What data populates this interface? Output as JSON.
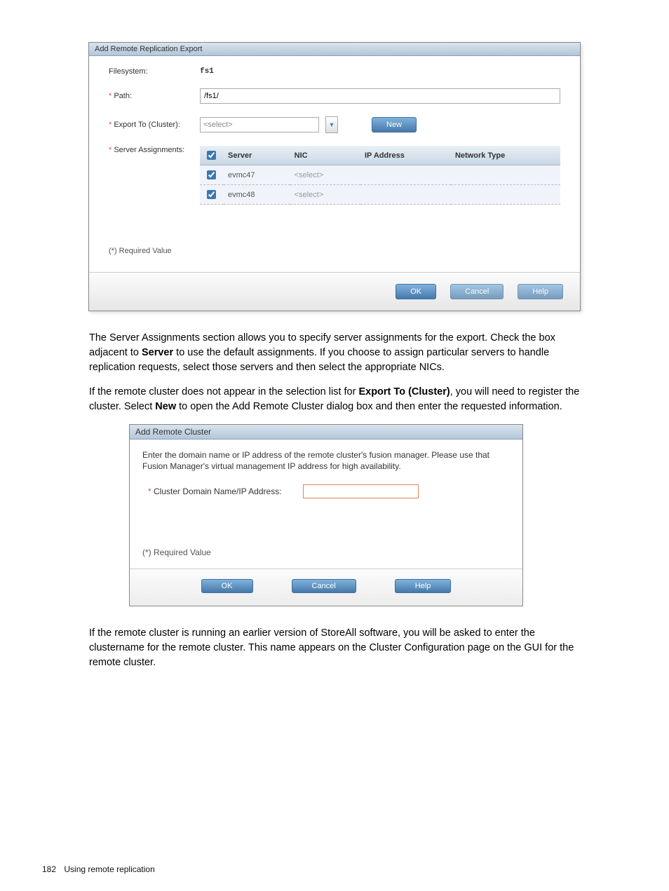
{
  "dialog1": {
    "title": "Add Remote Replication Export",
    "labels": {
      "filesystem": "Filesystem:",
      "path": "Path:",
      "export_to": "Export To (Cluster):",
      "server_assign": "Server Assignments:"
    },
    "values": {
      "filesystem": "fs1",
      "path": "/fs1/",
      "export_placeholder": "<select>"
    },
    "new_btn": "New",
    "table": {
      "headers": {
        "server": "Server",
        "nic": "NIC",
        "ip": "IP Address",
        "nettype": "Network Type"
      },
      "rows": [
        {
          "server": "evmc47",
          "nic": "<select>",
          "ip": "",
          "nettype": ""
        },
        {
          "server": "evmc48",
          "nic": "<select>",
          "ip": "",
          "nettype": ""
        }
      ]
    },
    "required_note": "(*) Required Value",
    "buttons": {
      "ok": "OK",
      "cancel": "Cancel",
      "help": "Help"
    }
  },
  "prose1": {
    "text_a": "The Server Assignments section allows you to specify server assignments for the export. Check the box adjacent to ",
    "bold_a": "Server",
    "text_b": " to use the default assignments. If you choose to assign particular servers to handle replication requests, select those servers and then select the appropriate NICs."
  },
  "prose2": {
    "text_a": "If the remote cluster does not appear in the selection list for ",
    "bold_a": "Export To (Cluster)",
    "text_b": ", you will need to register the cluster. Select ",
    "bold_b": "New",
    "text_c": " to open the Add Remote Cluster dialog box and then enter the requested information."
  },
  "dialog2": {
    "title": "Add Remote Cluster",
    "instruction": "Enter the domain name or IP address of the remote cluster's fusion manager. Please use that Fusion Manager's virtual management IP address for high availability.",
    "field_label": "Cluster Domain Name/IP Address:",
    "required_note": "(*) Required Value",
    "buttons": {
      "ok": "OK",
      "cancel": "Cancel",
      "help": "Help"
    }
  },
  "prose3": {
    "text": "If the remote cluster is running an earlier version of StoreAll software, you will be asked to enter the clustername for the remote cluster. This name appears on the Cluster Configuration page on the GUI for the remote cluster."
  },
  "footer": {
    "page_number": "182",
    "section": "Using remote replication"
  }
}
